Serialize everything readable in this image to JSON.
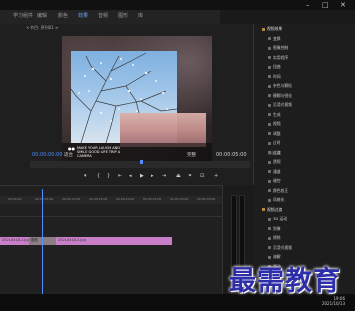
{
  "app": {
    "accent": "#4e8dff"
  },
  "workspace_tabs": [
    "学习",
    "组件",
    "编辑",
    "颜色",
    "效果",
    "音频",
    "图形",
    "库"
  ],
  "program_monitor": {
    "close_label": "×",
    "title": "节目: 序列01  ≡",
    "timecode_left": "00:00:00:00",
    "fit_label": "适合",
    "full_label": "完整",
    "timecode_right": "00:00:05:00",
    "photo_caption": "MAKE YOUR LAUGH AND SMILE GOOD LIFE TRIP A CAMERA"
  },
  "effects_panel": {
    "items": [
      "视频效果",
      "变换",
      "图像控制",
      "实用程序",
      "扭曲",
      "时间",
      "杂色与颗粒",
      "模糊与锐化",
      "沉浸式视频",
      "生成",
      "视频",
      "调整",
      "过时",
      "过渡",
      "透视",
      "通道",
      "键控",
      "颜色校正",
      "风格化",
      "视频过渡",
      "3D 运动",
      "划像",
      "擦除",
      "沉浸式视频",
      "溶解",
      "滑动",
      "缩放",
      "页面剥落"
    ],
    "highlight_index": 13
  },
  "timeline": {
    "ticks": [
      "00:00:00",
      "00:00:05:00",
      "00:00:10:00",
      "00:00:15:00",
      "00:00:20:00",
      "00:00:25:00",
      "00:00:30:00",
      "00:00:35:00"
    ],
    "clip1_label": "20210418-1.jpg",
    "clip_gray_label": "图形",
    "clip2_label": "20210418-2.jpg"
  },
  "taskbar": {
    "time": "19:06",
    "date": "2021/10/13"
  },
  "watermark": "最需教育"
}
